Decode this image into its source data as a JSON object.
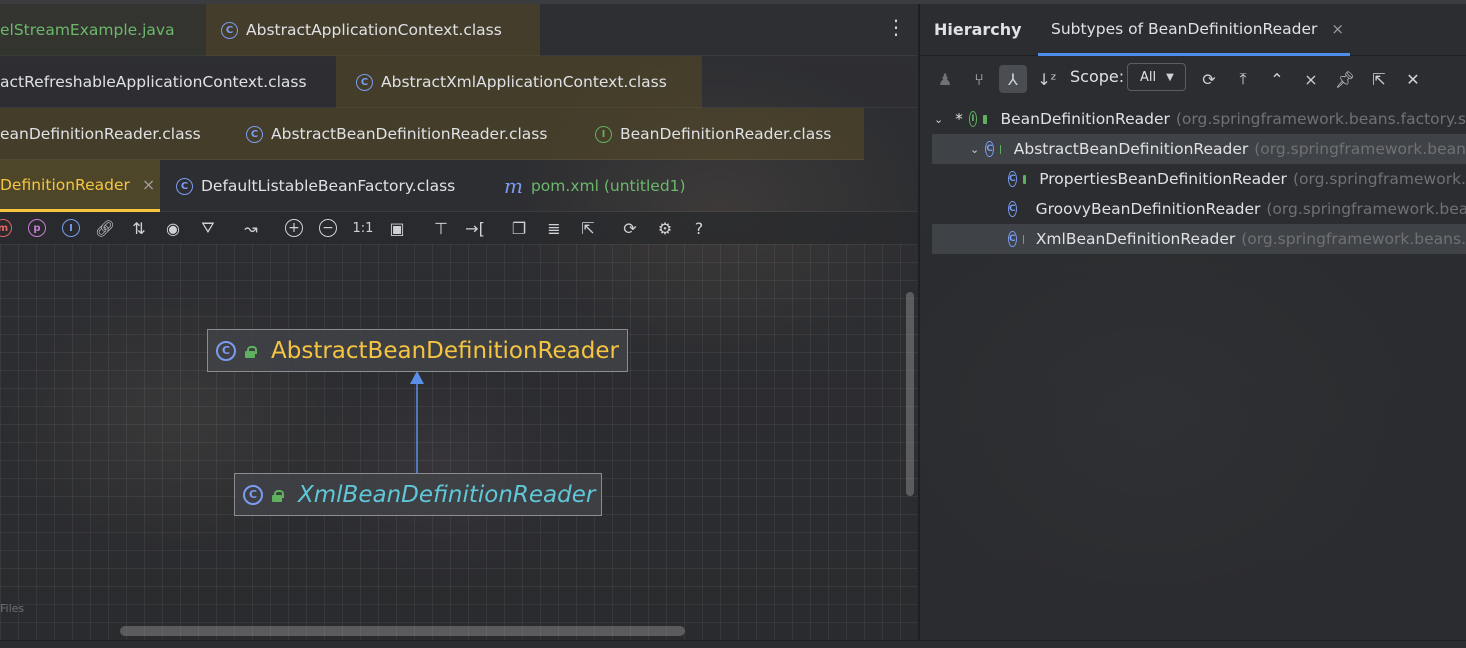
{
  "editor": {
    "tabs_row1": [
      {
        "label": "elStreamExample.java",
        "color": "#6bb86b"
      },
      {
        "label": "AbstractApplicationContext.class",
        "icon": "C"
      }
    ],
    "tabs_row2": [
      {
        "label": "actRefreshableApplicationContext.class"
      },
      {
        "label": "AbstractXmlApplicationContext.class",
        "icon": "C"
      }
    ],
    "tabs_row3": [
      {
        "label": "eanDefinitionReader.class"
      },
      {
        "label": "AbstractBeanDefinitionReader.class",
        "icon": "C"
      },
      {
        "label": "BeanDefinitionReader.class",
        "icon": "I"
      }
    ],
    "tabs_row4": [
      {
        "label": "DefinitionReader",
        "color": "#f5c542",
        "close": "×"
      },
      {
        "label": "DefaultListableBeanFactory.class",
        "icon": "C"
      },
      {
        "label": "pom.xml (untitled1)",
        "icon": "m",
        "color": "#6bb86b"
      }
    ],
    "more_icon": "⋮"
  },
  "diagram": {
    "toolbar": {
      "one_to_one": "1:1",
      "help": "?"
    },
    "nodes": [
      {
        "label": "AbstractBeanDefinitionReader",
        "color": "#f5c542",
        "italic": false
      },
      {
        "label": "XmlBeanDefinitionReader",
        "color": "#5fc8d8",
        "italic": true
      }
    ],
    "files_label": "Files"
  },
  "hierarchy": {
    "title": "Hierarchy",
    "tab_label": "Subtypes of BeanDefinitionReader",
    "tab_close": "×",
    "scope_label": "Scope:",
    "scope_value": "All",
    "tree": [
      {
        "name": "BeanDefinitionReader",
        "pkg": "(org.springframework.beans.factory.s",
        "icon": "I",
        "star": "*"
      },
      {
        "name": "AbstractBeanDefinitionReader",
        "pkg": "(org.springframework.bean",
        "icon": "C"
      },
      {
        "name": "PropertiesBeanDefinitionReader",
        "pkg": "(org.springframework.",
        "icon": "C"
      },
      {
        "name": "GroovyBeanDefinitionReader",
        "pkg": "(org.springframework.bea",
        "icon": "C"
      },
      {
        "name": "XmlBeanDefinitionReader",
        "pkg": "(org.springframework.beans.",
        "icon": "C"
      }
    ]
  },
  "colors": {
    "accent_blue": "#4f8cf0",
    "active_tab_underline": "#f5c542",
    "class_icon": "#7a9cf0",
    "interface_icon": "#5fb05f"
  }
}
